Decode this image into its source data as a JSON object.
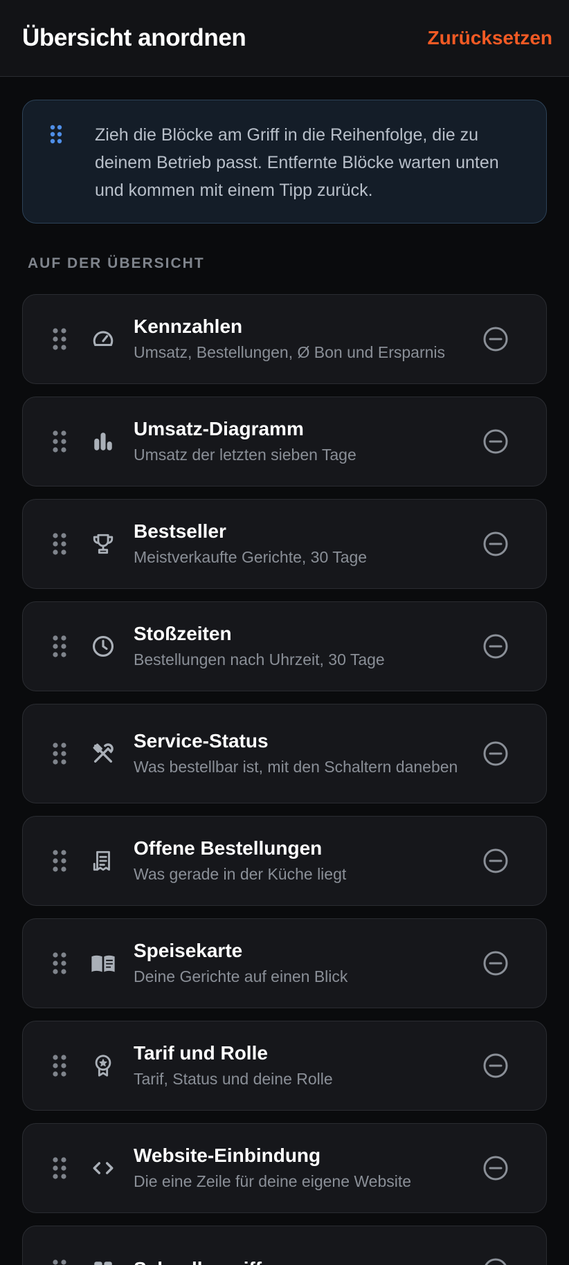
{
  "header": {
    "title": "Übersicht anordnen",
    "reset_label": "Zurücksetzen"
  },
  "info": {
    "text": "Zieh die Blöcke am Griff in die Reihenfolge, die zu deinem Betrieb passt. Entfernte Blöcke warten unten und kommen mit einem Tipp zurück."
  },
  "section": {
    "label": "AUF DER ÜBERSICHT"
  },
  "blocks": [
    {
      "icon": "gauge-icon",
      "title": "Kennzahlen",
      "subtitle": "Umsatz, Bestellungen, Ø Bon und Ersparnis"
    },
    {
      "icon": "bar-chart-icon",
      "title": "Umsatz-Diagramm",
      "subtitle": "Umsatz der letzten sieben Tage"
    },
    {
      "icon": "trophy-icon",
      "title": "Bestseller",
      "subtitle": "Meistverkaufte Gerichte, 30 Tage"
    },
    {
      "icon": "clock-icon",
      "title": "Stoßzeiten",
      "subtitle": "Bestellungen nach Uhrzeit, 30 Tage"
    },
    {
      "icon": "utensils-icon",
      "title": "Service-Status",
      "subtitle": "Was bestellbar ist, mit den Schaltern daneben"
    },
    {
      "icon": "receipt-icon",
      "title": "Offene Bestellungen",
      "subtitle": "Was gerade in der Küche liegt"
    },
    {
      "icon": "book-icon",
      "title": "Speisekarte",
      "subtitle": "Deine Gerichte auf einen Blick"
    },
    {
      "icon": "badge-icon",
      "title": "Tarif und Rolle",
      "subtitle": "Tarif, Status und deine Rolle"
    },
    {
      "icon": "code-icon",
      "title": "Website-Einbindung",
      "subtitle": "Die eine Zeile für deine eigene Website"
    },
    {
      "icon": "grid-icon",
      "title": "Schnellzugriff",
      "subtitle": ""
    }
  ],
  "colors": {
    "accent": "#f25a24",
    "info_icon": "#4f8fe8",
    "card_bg": "#16171b",
    "page_bg": "#0a0b0d"
  }
}
